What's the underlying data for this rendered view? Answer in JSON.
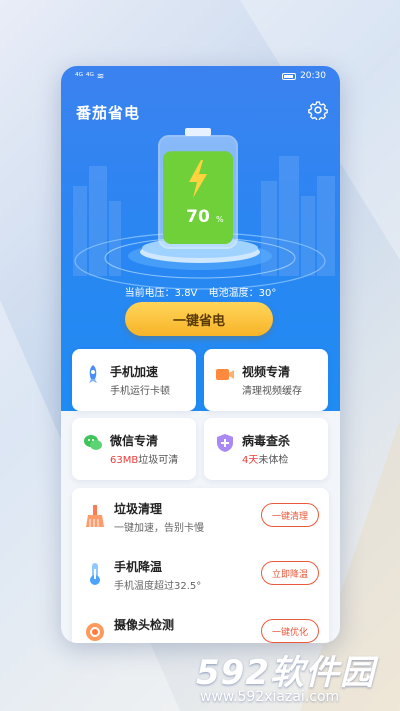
{
  "status_bar": {
    "signal": "⁴ᴳ ⁴ᴳ ≋",
    "time": "20:30"
  },
  "app": {
    "title": "番茄省电"
  },
  "battery": {
    "percent": "70",
    "unit": "%",
    "level": 0.7
  },
  "info": {
    "voltage": "当前电压：3.8V",
    "temperature": "电池温度：30°"
  },
  "save_button": {
    "label": "一键省电"
  },
  "cards": [
    {
      "title": "手机加速",
      "sub": "手机运行卡顿",
      "icon": "rocket-icon"
    },
    {
      "title": "视频专清",
      "sub": "清理视频缓存",
      "icon": "video-icon"
    },
    {
      "title": "微信专清",
      "sub_highlight": "63MB",
      "sub_rest": "垃圾可清",
      "icon": "wechat-icon"
    },
    {
      "title": "病毒查杀",
      "sub_highlight": "4天",
      "sub_rest": "未体检",
      "icon": "shield-icon"
    }
  ],
  "list": [
    {
      "title": "垃圾清理",
      "sub": "一键加速，告别卡慢",
      "button": "一键清理",
      "icon": "broom-icon"
    },
    {
      "title": "手机降温",
      "sub": "手机温度超过32.5°",
      "button": "立即降温",
      "icon": "thermometer-icon"
    },
    {
      "title": "摄像头检测",
      "sub": "",
      "button": "一键优化",
      "icon": "camera-icon"
    }
  ],
  "watermark": {
    "brand_num": "592",
    "brand_text": "软件园",
    "url": "www.592xiazai.com"
  },
  "colors": {
    "hero_blue": "#2a86f2",
    "accent_orange": "#f8b428",
    "alert_red": "#ee3b3b",
    "battery_green": "#6fd03a"
  }
}
